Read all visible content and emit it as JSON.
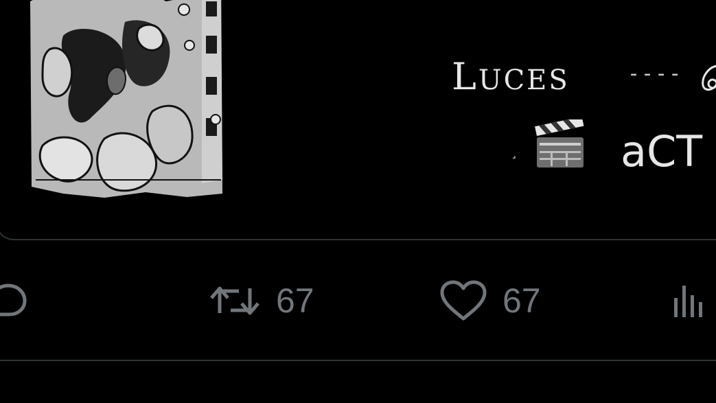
{
  "card": {
    "title_prefix": "L",
    "title_rest": "UCES",
    "title_dashes": "----",
    "subtitle_mark": "¸",
    "subtitle_text": "aCT"
  },
  "actions": {
    "retweets": "67",
    "likes": "67"
  },
  "icons": {
    "reply": "reply-icon",
    "retweet": "retweet-icon",
    "like": "heart-icon",
    "views": "views-chart-icon",
    "clapper": "clapper-board-icon"
  },
  "colors": {
    "background": "#000000",
    "muted": "#71767b",
    "border": "#2f3336",
    "text": "#e6e6e6"
  }
}
